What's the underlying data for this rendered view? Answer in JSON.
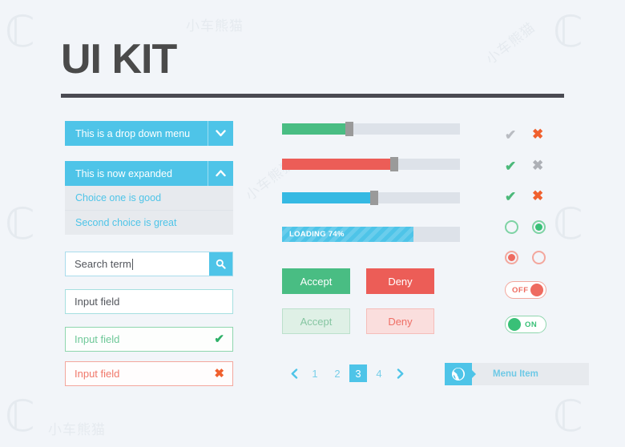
{
  "page": {
    "title": "UI KIT",
    "background_color": "#f2f5f9",
    "accent_blue": "#4ec4e8",
    "accent_green": "#49bd83",
    "accent_red": "#ec5d57",
    "accent_orange": "#f0602e"
  },
  "watermarks": [
    {
      "text": "CL",
      "style": "big"
    },
    {
      "text": "小车熊猫",
      "style": "small"
    }
  ],
  "dropdowns": {
    "collapsed": {
      "label": "This is a drop down menu",
      "arrow_icon": "chevron-down-icon"
    },
    "expanded": {
      "label": "This is now expanded",
      "arrow_icon": "chevron-up-icon",
      "options": [
        "Choice one is good",
        "Second choice is great"
      ]
    }
  },
  "search": {
    "value": "Search term",
    "button_icon": "search-icon"
  },
  "fields": [
    {
      "value": "Input field",
      "state": "default",
      "icon": ""
    },
    {
      "value": "Input field",
      "state": "valid",
      "icon": "check-icon",
      "glyph": "✔"
    },
    {
      "value": "Input field",
      "state": "error",
      "icon": "cross-icon",
      "glyph": "✖"
    }
  ],
  "sliders": [
    {
      "name": "green-slider",
      "value": 38,
      "color": "#49bd83"
    },
    {
      "name": "red-slider",
      "value": 63,
      "color": "#ec5d57"
    },
    {
      "name": "blue-slider",
      "value": 52,
      "color": "#35b9e3"
    }
  ],
  "progress": {
    "label": "LOADING 74%",
    "value": 74,
    "color": "#4ec4e8"
  },
  "buttons": [
    {
      "label": "Accept",
      "style": "accept-solid"
    },
    {
      "label": "Deny",
      "style": "deny-solid"
    },
    {
      "label": "Accept",
      "style": "accept-ghost"
    },
    {
      "label": "Deny",
      "style": "deny-ghost"
    }
  ],
  "pagination": {
    "prev_icon": "chevron-left-icon",
    "next_icon": "chevron-right-icon",
    "pages": [
      "1",
      "2",
      "3",
      "4"
    ],
    "active": "3"
  },
  "menu_item": {
    "label": "Menu Item",
    "icon": "globe-icon"
  },
  "marks": [
    {
      "check": "✔",
      "check_state": "grey",
      "cross": "✖",
      "cross_state": "orange"
    },
    {
      "check": "✔",
      "check_state": "green",
      "cross": "✖",
      "cross_state": "grey"
    },
    {
      "check": "✔",
      "check_state": "green",
      "cross": "✖",
      "cross_state": "orange"
    }
  ],
  "radios": [
    {
      "name": "radio-green-empty",
      "color": "green",
      "selected": false
    },
    {
      "name": "radio-green-selected",
      "color": "green",
      "selected": true
    },
    {
      "name": "radio-red-selected",
      "color": "red",
      "selected": true
    },
    {
      "name": "radio-red-empty",
      "color": "red",
      "selected": false
    }
  ],
  "toggles": [
    {
      "label": "OFF",
      "state": "off"
    },
    {
      "label": "ON",
      "state": "on"
    }
  ]
}
